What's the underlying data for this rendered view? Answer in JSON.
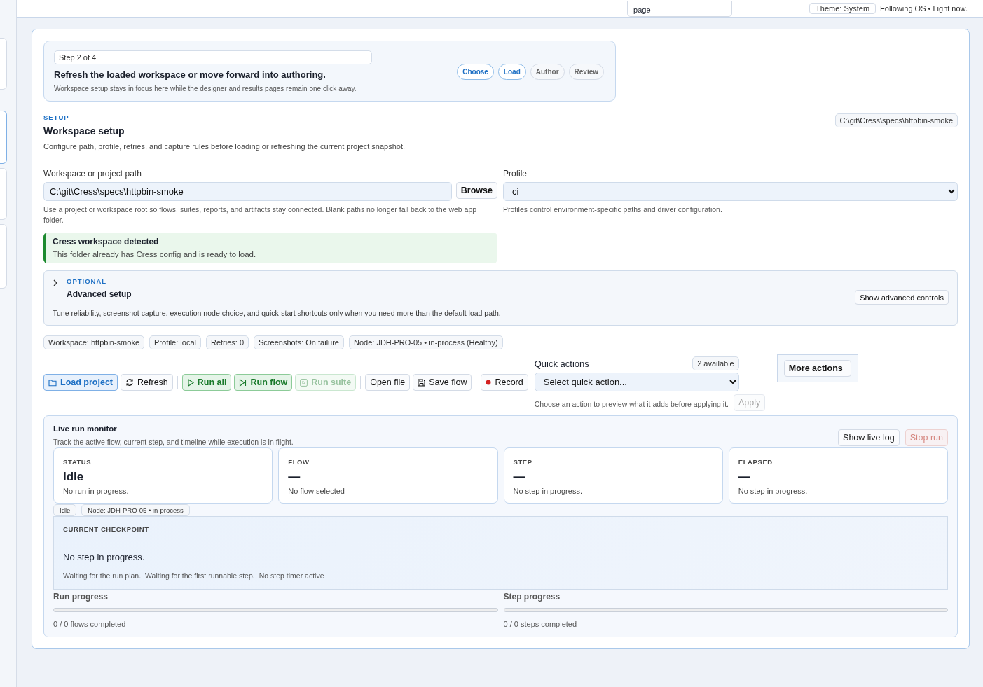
{
  "header": {
    "note": "page",
    "theme_button": "Theme: System",
    "theme_status": "Following OS • Light now."
  },
  "stepper": {
    "step_label": "Step 2 of 4",
    "title": "Refresh the loaded workspace or move forward into authoring.",
    "description": "Workspace setup stays in focus here while the designer and results pages remain one click away.",
    "steps": [
      {
        "label": "Choose",
        "active": true
      },
      {
        "label": "Load",
        "active": true
      },
      {
        "label": "Author",
        "active": false
      },
      {
        "label": "Review",
        "active": false
      }
    ]
  },
  "setup": {
    "eyebrow": "SETUP",
    "title": "Workspace setup",
    "description": "Configure path, profile, retries, and capture rules before loading or refreshing the current project snapshot.",
    "path_badge": "C:\\git\\Cress\\specs\\httpbin-smoke"
  },
  "path_field": {
    "label": "Workspace or project path",
    "value": "C:\\git\\Cress\\specs\\httpbin-smoke",
    "browse": "Browse",
    "help": "Use a project or workspace root so flows, suites, reports, and artifacts stay connected. Blank paths no longer fall back to the web app folder."
  },
  "profile_field": {
    "label": "Profile",
    "value": "ci",
    "help": "Profiles control environment-specific paths and driver configuration."
  },
  "detected": {
    "title": "Cress workspace detected",
    "text": "This folder already has Cress config and is ready to load."
  },
  "advanced": {
    "eyebrow": "OPTIONAL",
    "title": "Advanced setup",
    "expanded": false,
    "description": "Tune reliability, screenshot capture, execution node choice, and quick-start shortcuts only when you need more than the default load path.",
    "button": "Show advanced controls"
  },
  "summary_chips": [
    "Workspace: httpbin-smoke",
    "Profile: local",
    "Retries: 0",
    "Screenshots: On failure",
    "Node: JDH-PRO-05 • in-process (Healthy)"
  ],
  "toolbar": [
    {
      "label": "Load project",
      "kind": "primary",
      "disabled": false
    },
    {
      "label": "Refresh",
      "kind": "default",
      "disabled": false
    },
    {
      "label": "Run all",
      "kind": "success",
      "disabled": false
    },
    {
      "label": "Run flow",
      "kind": "success",
      "disabled": false
    },
    {
      "label": "Run suite",
      "kind": "success",
      "disabled": true
    },
    {
      "label": "Open file",
      "kind": "default",
      "disabled": false
    },
    {
      "label": "Save flow",
      "kind": "default",
      "disabled": false
    },
    {
      "label": "Record",
      "kind": "default",
      "disabled": false
    }
  ],
  "quick_actions": {
    "label": "Quick actions",
    "count": "2 available",
    "placeholder": "Select quick action...",
    "help": "Choose an action to preview what it adds before applying it.",
    "apply": "Apply",
    "apply_disabled": true,
    "more": "More actions"
  },
  "monitor": {
    "title": "Live run monitor",
    "description": "Track the active flow, current step, and timeline while execution is in flight.",
    "log_button": "Show live log",
    "stop_button": "Stop run",
    "stop_disabled": true,
    "cards": [
      {
        "label": "STATUS",
        "value": "Idle",
        "detail": "No run in progress."
      },
      {
        "label": "FLOW",
        "value": "—",
        "detail": "No flow selected"
      },
      {
        "label": "STEP",
        "value": "—",
        "detail": "No step in progress."
      },
      {
        "label": "ELAPSED",
        "value": "—",
        "detail": "No step in progress."
      }
    ],
    "chips": [
      "Idle",
      "Node: JDH-PRO-05 • in-process"
    ],
    "checkpoint": {
      "label": "CURRENT CHECKPOINT",
      "value": "—",
      "title": "No step in progress.",
      "notes": [
        "Waiting for the run plan.",
        "Waiting for the first runnable step.",
        "No step timer active"
      ]
    },
    "progress": [
      {
        "label": "Run progress",
        "level": 0,
        "text": "0 / 0 flows completed"
      },
      {
        "label": "Step progress",
        "level": 0,
        "text": "0 / 0 steps completed"
      }
    ]
  }
}
